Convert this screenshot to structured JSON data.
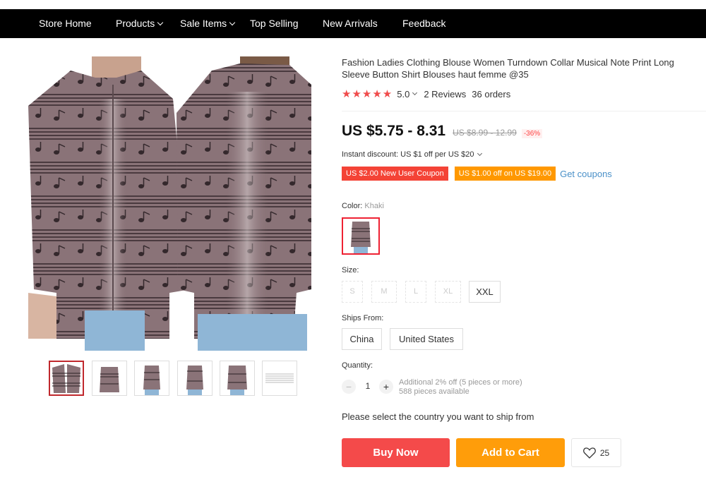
{
  "nav": {
    "items": [
      {
        "label": "Store Home",
        "dropdown": false
      },
      {
        "label": "Products",
        "dropdown": true
      },
      {
        "label": "Sale Items",
        "dropdown": true
      },
      {
        "label": "Top Selling",
        "dropdown": false
      },
      {
        "label": "New Arrivals",
        "dropdown": false
      },
      {
        "label": "Feedback",
        "dropdown": false
      }
    ]
  },
  "product": {
    "title": "Fashion Ladies Clothing Blouse Women Turndown Collar Musical Note Print Long Sleeve Button Shirt Blouses haut femme @35",
    "rating_stars": "★★★★★",
    "rating": "5.0",
    "reviews": "2 Reviews",
    "orders": "36 orders",
    "price": "US $5.75 - 8.31",
    "original_price": "US $8.99 - 12.99",
    "discount": "-36%",
    "instant_discount": "Instant discount: US $1 off per US $20",
    "coupons": [
      "US $2.00 New User Coupon",
      "US $1.00 off on US $19.00"
    ],
    "get_coupons": "Get coupons",
    "color_label": "Color:",
    "color_value": "Khaki",
    "size_label": "Size:",
    "sizes": [
      {
        "label": "S",
        "available": false
      },
      {
        "label": "M",
        "available": false
      },
      {
        "label": "L",
        "available": false
      },
      {
        "label": "XL",
        "available": false
      },
      {
        "label": "XXL",
        "available": true
      }
    ],
    "ships_from_label": "Ships From:",
    "ships_from": [
      "China",
      "United States"
    ],
    "quantity_label": "Quantity:",
    "quantity": "1",
    "quantity_note_1": "Additional 2% off (5 pieces or more)",
    "quantity_note_2": "588 pieces available",
    "ship_message": "Please select the country you want to ship from",
    "buy_now": "Buy Now",
    "add_to_cart": "Add to Cart",
    "wishlist_count": "25"
  },
  "colors": {
    "nav_bg": "#000000",
    "price_red": "#f44a4a",
    "cart_orange": "#ff9d0a",
    "star_red": "#f04b4b",
    "link_blue": "#4a90c8",
    "shirt": "#8a7378"
  },
  "icons": {
    "wishlist": "heart-icon",
    "dropdown": "chevron-down-icon"
  }
}
